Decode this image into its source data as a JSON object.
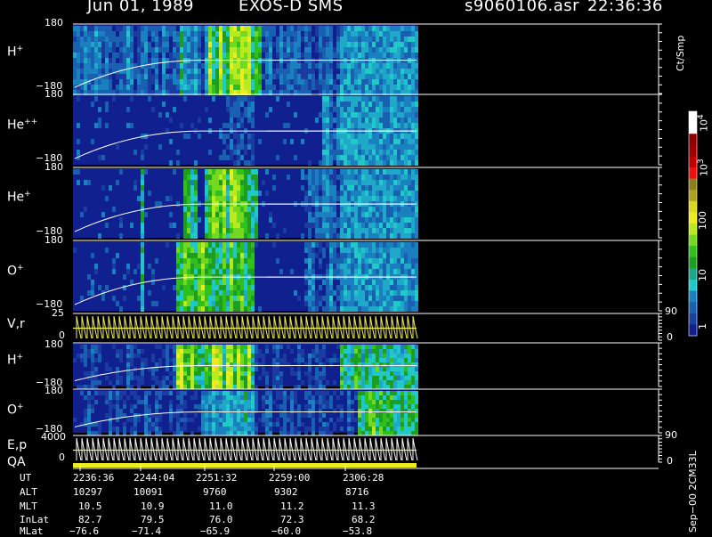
{
  "header": {
    "date": "Jun 01, 1989",
    "instrument": "EXOS-D SMS",
    "filename": "s9060106.asr",
    "time": "22:36:36"
  },
  "panels": [
    {
      "id": "h-plus-1",
      "label": "H",
      "sup": "+",
      "ytop": "180",
      "ybot": "−180"
    },
    {
      "id": "he-pp",
      "label": "He",
      "sup": "++",
      "ytop": "180",
      "ybot": "−180"
    },
    {
      "id": "he-plus",
      "label": "He",
      "sup": "+",
      "ytop": "180",
      "ybot": "−180"
    },
    {
      "id": "o-plus-1",
      "label": "O",
      "sup": "+",
      "ytop": "180",
      "ybot": "−180"
    },
    {
      "id": "vr",
      "label": "V,r",
      "sup": "",
      "ytop": "25",
      "ybot": "0",
      "rtop": "90",
      "rbot": "0"
    },
    {
      "id": "h-plus-2",
      "label": "H",
      "sup": "+",
      "ytop": "180",
      "ybot": "−180"
    },
    {
      "id": "o-plus-2",
      "label": "O",
      "sup": "+",
      "ytop": "180",
      "ybot": "−180"
    },
    {
      "id": "ep",
      "label": "E,p",
      "sup": "",
      "ytop": "4000",
      "ybot": "0",
      "rtop": "90",
      "rbot": "0"
    }
  ],
  "qa_label": "QA",
  "colorbar": {
    "unit": "Ct/Smp",
    "ticks": [
      {
        "base": "10",
        "exp": "4"
      },
      {
        "base": "10",
        "exp": "3"
      },
      {
        "base": "100",
        "exp": ""
      },
      {
        "base": "10",
        "exp": ""
      },
      {
        "base": "1",
        "exp": ""
      }
    ],
    "colors": [
      "#ffffff",
      "#ffffff",
      "#8b0000",
      "#a00000",
      "#c00000",
      "#ee1010",
      "#8a7f1a",
      "#b0a020",
      "#d8d820",
      "#ecec20",
      "#b8ea20",
      "#74d820",
      "#2fbf1e",
      "#1e9e20",
      "#1aa888",
      "#20c8c8",
      "#1a80c0",
      "#1a60b0",
      "#1a40a0",
      "#10208e"
    ]
  },
  "footer": {
    "rows": [
      {
        "label": "UT",
        "values": [
          "2236:36",
          "2244:04",
          "2251:32",
          "2259:00",
          "2306:28"
        ]
      },
      {
        "label": "ALT",
        "values": [
          "10297",
          "10091",
          "9760",
          "9302",
          "8716"
        ]
      },
      {
        "label": "MLT",
        "values": [
          "10.5",
          "10.9",
          "11.0",
          "11.2",
          "11.3"
        ]
      },
      {
        "label": "InLat",
        "values": [
          "82.7",
          "79.5",
          "76.0",
          "72.3",
          "68.2"
        ]
      },
      {
        "label": "MLat",
        "values": [
          "−76.6",
          "−71.4",
          "−65.9",
          "−60.0",
          "−53.8"
        ]
      }
    ],
    "stamp": "Sep−00 2CM33L"
  },
  "chart_data": {
    "type": "heatmap",
    "title": "Jun 01, 1989   EXOS-D SMS",
    "x": [
      "2236:36",
      "2244:04",
      "2251:32",
      "2259:00",
      "2306:28"
    ],
    "xlabel": "UT",
    "series": [
      {
        "name": "H+",
        "ylim": [
          -180,
          180
        ]
      },
      {
        "name": "He++",
        "ylim": [
          -180,
          180
        ]
      },
      {
        "name": "He+",
        "ylim": [
          -180,
          180
        ]
      },
      {
        "name": "O+",
        "ylim": [
          -180,
          180
        ]
      },
      {
        "name": "V,r",
        "ylim": [
          0,
          25
        ]
      },
      {
        "name": "H+",
        "ylim": [
          -180,
          180
        ]
      },
      {
        "name": "O+",
        "ylim": [
          -180,
          180
        ]
      },
      {
        "name": "E,p",
        "ylim": [
          0,
          4000
        ]
      }
    ],
    "colorbar": {
      "unit": "Ct/Smp",
      "scale": "log",
      "range": [
        1,
        10000
      ]
    },
    "ephemeris": {
      "ALT": [
        10297,
        10091,
        9760,
        9302,
        8716
      ],
      "MLT": [
        10.5,
        10.9,
        11.0,
        11.2,
        11.3
      ],
      "InLat": [
        82.7,
        79.5,
        76.0,
        72.3,
        68.2
      ],
      "MLat": [
        -76.6,
        -71.4,
        -65.9,
        -60.0,
        -53.8
      ]
    }
  }
}
